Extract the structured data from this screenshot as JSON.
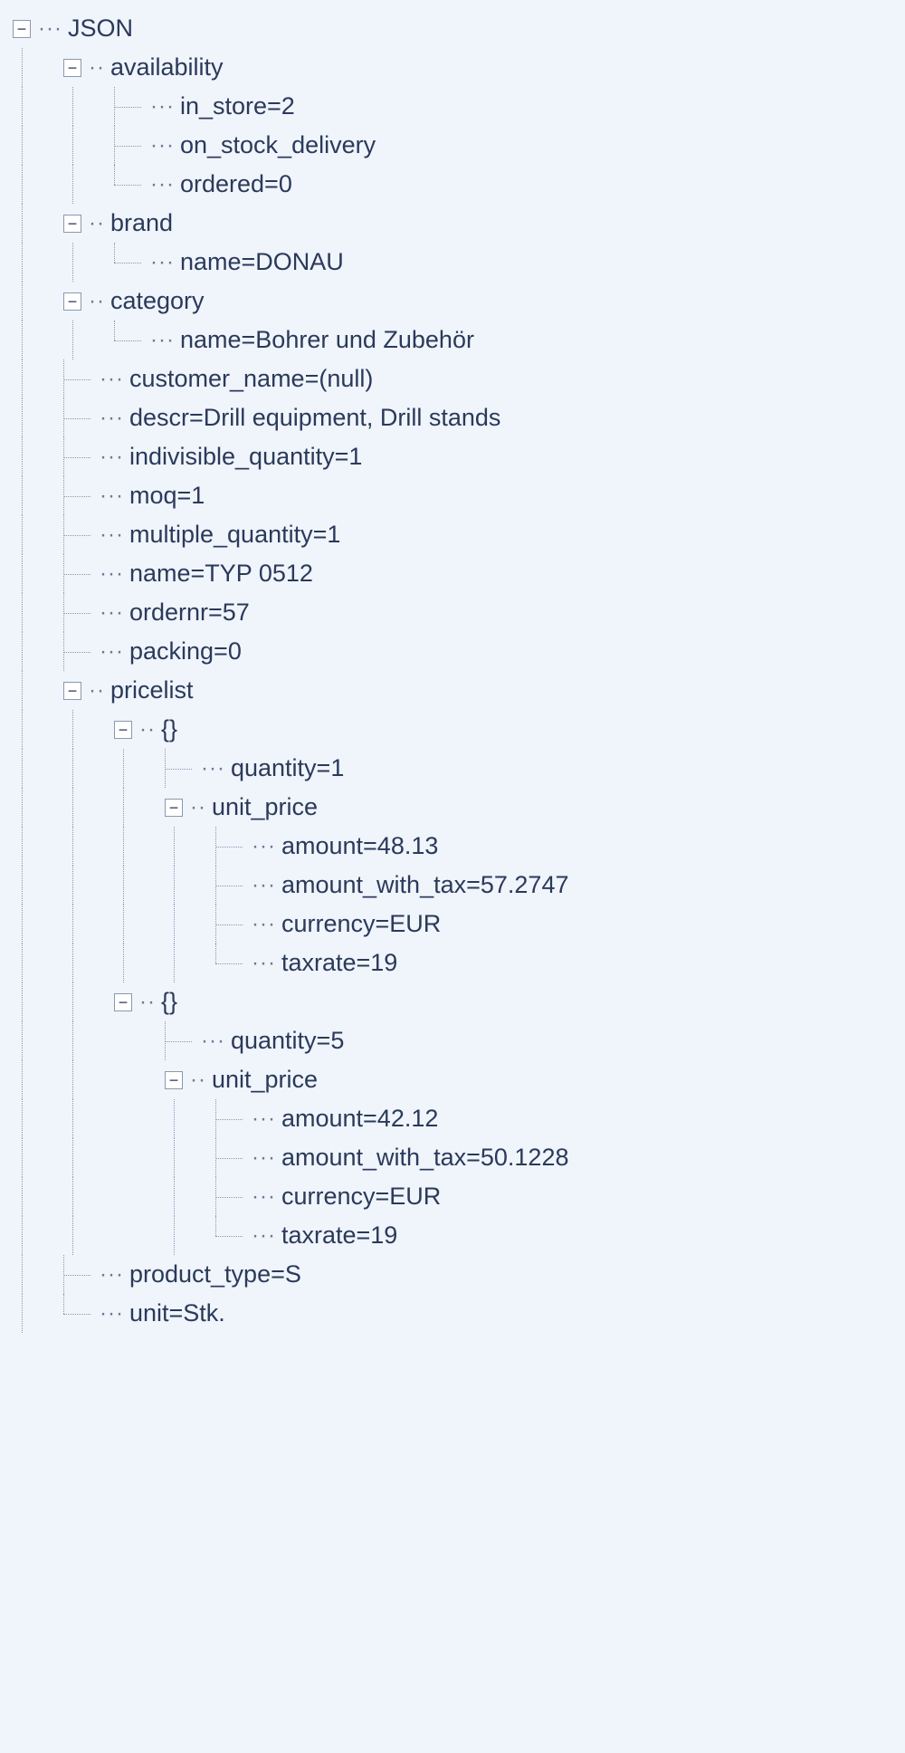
{
  "root_label": "JSON",
  "nodes": {
    "availability": {
      "label": "availability",
      "children": {
        "in_store": "in_store=2",
        "on_stock_delivery": "on_stock_delivery",
        "ordered": "ordered=0"
      }
    },
    "brand": {
      "label": "brand",
      "children": {
        "name": "name=DONAU"
      }
    },
    "category": {
      "label": "category",
      "children": {
        "name": "name=Bohrer und Zubehör"
      }
    },
    "customer_name": "customer_name=(null)",
    "descr": "descr=Drill equipment, Drill stands",
    "indivisible_quantity": "indivisible_quantity=1",
    "moq": "moq=1",
    "multiple_quantity": "multiple_quantity=1",
    "name": "name=TYP 0512",
    "ordernr": "ordernr=57",
    "packing": "packing=0",
    "pricelist": {
      "label": "pricelist",
      "items": [
        {
          "label": "{}",
          "quantity": "quantity=1",
          "unit_price": {
            "label": "unit_price",
            "amount": "amount=48.13",
            "amount_with_tax": "amount_with_tax=57.2747",
            "currency": "currency=EUR",
            "taxrate": "taxrate=19"
          }
        },
        {
          "label": "{}",
          "quantity": "quantity=5",
          "unit_price": {
            "label": "unit_price",
            "amount": "amount=42.12",
            "amount_with_tax": "amount_with_tax=50.1228",
            "currency": "currency=EUR",
            "taxrate": "taxrate=19"
          }
        }
      ]
    },
    "product_type": "product_type=S",
    "unit": "unit=Stk."
  },
  "toggles": {
    "minus": "−",
    "plus": "+"
  }
}
